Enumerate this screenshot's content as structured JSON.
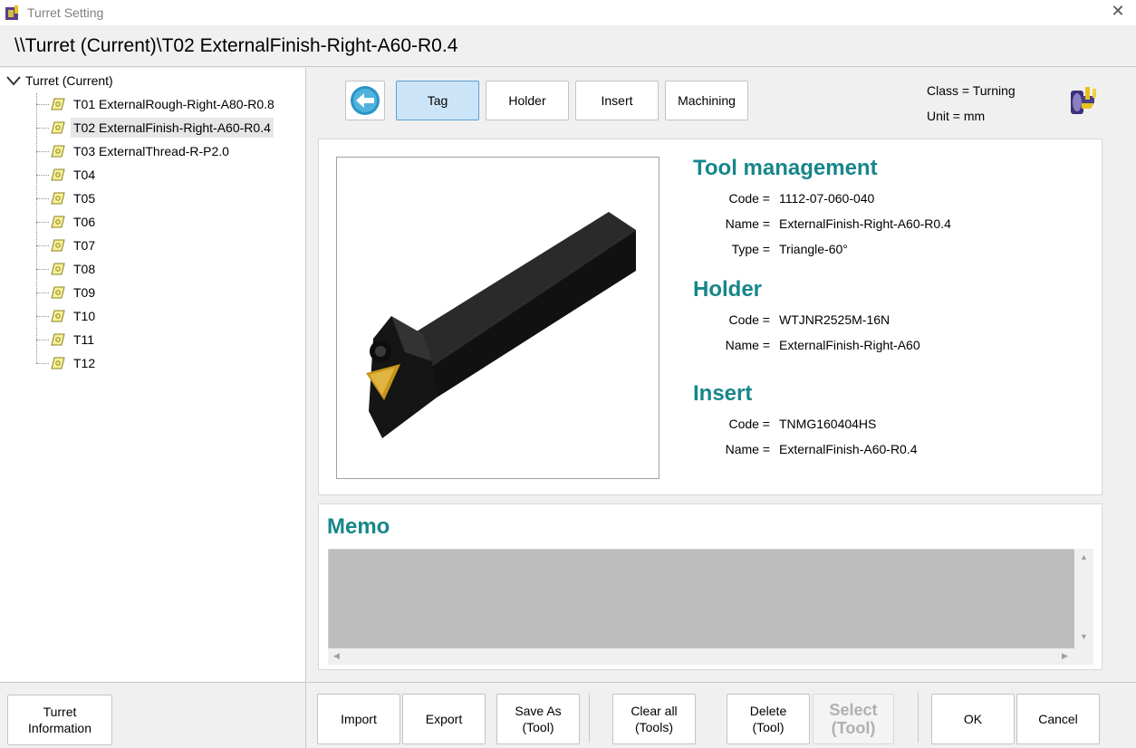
{
  "window": {
    "title": "Turret Setting",
    "close_glyph": "✕"
  },
  "path": "\\\\Turret (Current)\\T02 ExternalFinish-Right-A60-R0.4",
  "tree": {
    "root": "Turret (Current)",
    "items": [
      {
        "label": "T01 ExternalRough-Right-A80-R0.8"
      },
      {
        "label": "T02 ExternalFinish-Right-A60-R0.4"
      },
      {
        "label": "T03 ExternalThread-R-P2.0"
      },
      {
        "label": "T04"
      },
      {
        "label": "T05"
      },
      {
        "label": "T06"
      },
      {
        "label": "T07"
      },
      {
        "label": "T08"
      },
      {
        "label": "T09"
      },
      {
        "label": "T10"
      },
      {
        "label": "T11"
      },
      {
        "label": "T12"
      }
    ],
    "selected_index": 1
  },
  "tabs": {
    "tag": "Tag",
    "holder": "Holder",
    "insert": "Insert",
    "machining": "Machining",
    "active": "Tag"
  },
  "classinfo": {
    "class": "Class = Turning",
    "unit": "Unit = mm"
  },
  "tool_management": {
    "title": "Tool management",
    "code_label": "Code =",
    "code": "1112-07-060-040",
    "name_label": "Name =",
    "name": "ExternalFinish-Right-A60-R0.4",
    "type_label": "Type =",
    "type": "Triangle-60°"
  },
  "holder": {
    "title": "Holder",
    "code_label": "Code =",
    "code": "WTJNR2525M-16N",
    "name_label": "Name =",
    "name": "ExternalFinish-Right-A60"
  },
  "insert": {
    "title": "Insert",
    "code_label": "Code =",
    "code": "TNMG160404HS",
    "name_label": "Name =",
    "name": "ExternalFinish-A60-R0.4"
  },
  "memo": {
    "title": "Memo",
    "value": ""
  },
  "buttons": {
    "turret_info_1": "Turret",
    "turret_info_2": "Information",
    "import": "Import",
    "export": "Export",
    "save_as_1": "Save As",
    "save_as_2": "(Tool)",
    "clear_all_1": "Clear all",
    "clear_all_2": "(Tools)",
    "delete_1": "Delete",
    "delete_2": "(Tool)",
    "select_1": "Select",
    "select_2": "(Tool)",
    "ok": "OK",
    "cancel": "Cancel"
  },
  "colors": {
    "section_title": "#17868a",
    "active_tab": "#cce4f7",
    "back_arrow": "#2a95c6",
    "memo_bg": "#bdbdbd"
  },
  "icons": {
    "app": "turret-app-icon",
    "tree_item": "insert-icon",
    "back": "back-arrow-icon",
    "turret": "turret-icon"
  }
}
